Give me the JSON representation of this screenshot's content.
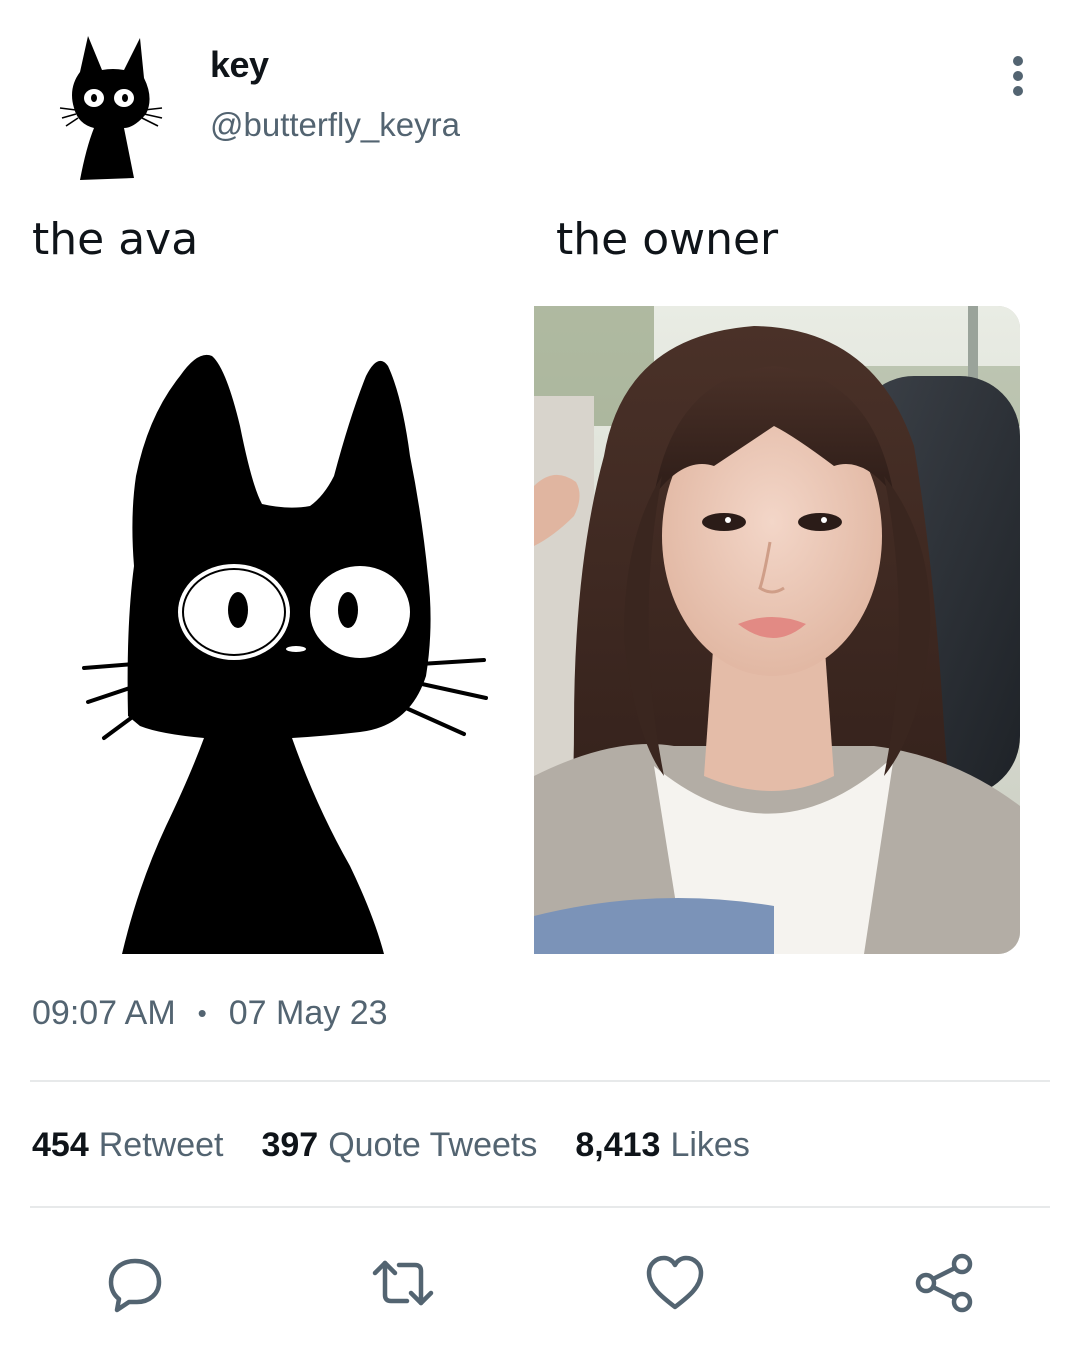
{
  "user": {
    "name": "key",
    "handle": "@butterfly_keyra"
  },
  "tweet": {
    "caption_left": "the ava",
    "caption_right": "the owner",
    "time": "09:07 AM",
    "separator": "•",
    "date": "07 May 23"
  },
  "stats": [
    {
      "count": "454",
      "label": "Retweet"
    },
    {
      "count": "397",
      "label": "Quote Tweets"
    },
    {
      "count": "8,413",
      "label": "Likes"
    }
  ],
  "icons": {
    "more": "more-vertical-icon",
    "reply": "reply-icon",
    "retweet": "retweet-icon",
    "like": "heart-icon",
    "share": "share-icon"
  },
  "colors": {
    "text": "#0f1419",
    "secondary": "#536471",
    "divider": "#e7e9ea"
  }
}
